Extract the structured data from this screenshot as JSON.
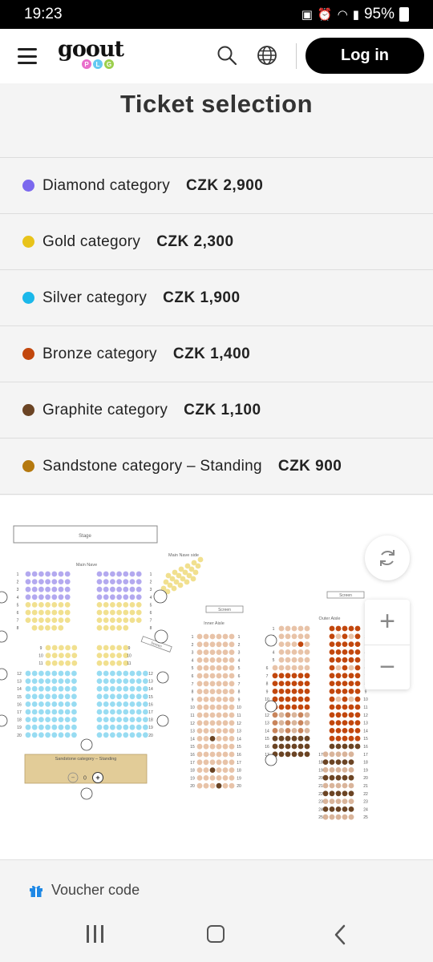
{
  "status_bar": {
    "time": "19:23",
    "battery": "95%"
  },
  "header": {
    "logo_text": "goout",
    "logo_sub": [
      "P",
      "L",
      "G"
    ],
    "login_label": "Log in"
  },
  "page": {
    "title": "Ticket selection"
  },
  "categories": [
    {
      "name": "Diamond category",
      "price": "CZK 2,900",
      "color": "#7b68ee"
    },
    {
      "name": "Gold category",
      "price": "CZK 2,300",
      "color": "#e8c31a"
    },
    {
      "name": "Silver category",
      "price": "CZK 1,900",
      "color": "#1bb8ea"
    },
    {
      "name": "Bronze category",
      "price": "CZK 1,400",
      "color": "#c2470d"
    },
    {
      "name": "Graphite category",
      "price": "CZK 1,100",
      "color": "#6b4424"
    },
    {
      "name": "Sandstone category – Standing",
      "price": "CZK 900",
      "color": "#b5790f"
    }
  ],
  "seat_map": {
    "stage_label": "Stage",
    "main_nave_label": "Main Nave",
    "main_nave_side_label": "Main Nave side",
    "screen_label": "Screen",
    "inner_aisle_label": "Inner Aisle",
    "outer_aisle_label": "Outer Aisle",
    "standing_label": "Sandstone category – Standing",
    "standing_count": "0"
  },
  "voucher": {
    "label": "Voucher code"
  }
}
